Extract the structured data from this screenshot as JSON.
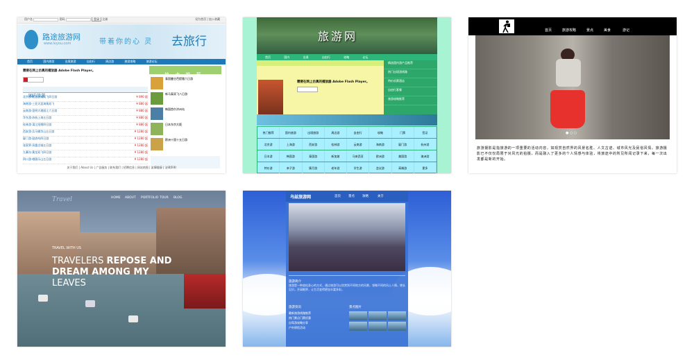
{
  "tile1": {
    "topbar_left": "用户名",
    "topbar_mid": "密码",
    "topbar_btn1": "登录",
    "topbar_btn2": "注册",
    "topbar_right": "设为首页 | 加入收藏",
    "logo_text": "路途旅游网",
    "logo_url": "www.lvyou.com",
    "slogan": "带着你的心 灵",
    "slogan_big": "去旅行",
    "nav": [
      "首页",
      "国内旅游",
      "出境旅游",
      "自由行",
      "周边游",
      "旅游攻略",
      "旅游论坛"
    ],
    "flash_message": "需要在网上仿真的播放器 Adobe Flash Player。",
    "section_title": "国内旅游",
    "rows": [
      {
        "name": "北京游·故宫长城双飞四日游",
        "price": "¥ 890 起"
      },
      {
        "name": "海南游·三亚天涯海角双飞",
        "price": "¥ 880 起"
      },
      {
        "name": "云南游·昆明大理丽江六日游",
        "price": "¥ 880 起"
      },
      {
        "name": "华东游·苏杭上海五日游",
        "price": "¥ 880 起"
      },
      {
        "name": "桂林游·漓江阳朔四日游",
        "price": "¥ 880 起"
      },
      {
        "name": "西安游·兵马俑华山五日游",
        "price": "¥ 1280 起"
      },
      {
        "name": "厦门游·鼓浪屿四日游",
        "price": "¥ 1280 起"
      },
      {
        "name": "张家界·凤凰古城五日游",
        "price": "¥ 1280 起"
      },
      {
        "name": "九寨沟·黄龙双飞四日游",
        "price": "¥ 1280 起"
      },
      {
        "name": "四川游·峨眉乐山五日游",
        "price": "¥ 1280 起"
      }
    ],
    "right_title": "热 点 推 荐",
    "right_items": [
      "泰国曼谷芭提雅六日游",
      "新马泰双飞八日游",
      "韩国首尔济州岛",
      "日本东京大阪",
      "欧洲十国十五日游"
    ],
    "footer": "关于我们 | About Us | 广告服务 | 联系我们 | 招聘信息 | 网站地图 | 友情链接 | 法律声明"
  },
  "tile2": {
    "title": "旅游网",
    "nav": [
      "首页",
      "国内",
      "出境",
      "自由行",
      "攻略",
      "论坛"
    ],
    "flash_message": "需要在网上仿真的播放器 Adobe Flash Player。",
    "green_list": [
      "精选国内游产品推荐",
      "热门出境游线路",
      "特价机票酒店",
      "自由行套餐",
      "旅游攻略推荐"
    ],
    "grid": [
      [
        "热门推荐",
        "国内旅游",
        "出境旅游",
        "周边游",
        "自由行",
        "攻略",
        "门票",
        "签证"
      ],
      [
        "北京游",
        "上海游",
        "西安游",
        "桂林游",
        "云南游",
        "海南游",
        "厦门游",
        "杭州游"
      ],
      [
        "日本游",
        "韩国游",
        "泰国游",
        "新加坡",
        "马来西亚",
        "欧洲游",
        "美国游",
        "澳洲游"
      ],
      [
        "特价游",
        "亲子游",
        "蜜月游",
        "老年游",
        "学生游",
        "会议游",
        "高端游",
        "更多"
      ]
    ]
  },
  "tile3": {
    "nav": [
      "首页",
      "旅游攻略",
      "景点",
      "美食",
      "游记"
    ],
    "dots": "● ○ ○",
    "paragraph": "旅游摄影是指旅游的一项重要的活动内容，如观赏自然界的风景名胜、人文古迹、城市风光及民俗风情。旅游摄影已不仅仅局限于对风光的拍摄，而是融入了更多的个人情感与体验，将旅途中的所见所闻记录下来，每一次出发都是新的开始。"
  },
  "tile4": {
    "logo": "Travel",
    "nav": [
      "HOME",
      "ABOUT",
      "PORTFOLIO",
      "TOUR",
      "BLOG"
    ],
    "kicker": "TRAVEL WITH US",
    "heading_line1_light": "TRAVELERS",
    "heading_line1_bold": "REPOSE AND",
    "heading_line2": "DREAM AMONG MY",
    "heading_line3": "LEAVES"
  },
  "tile5": {
    "brand": "乌兹旅游网",
    "nav": [
      "首页",
      "景点",
      "攻略",
      "关于"
    ],
    "intro_label": "旅游简介",
    "intro_text": "旅游是一种放松身心的方式，通过旅游可以欣赏到不同地方的风景，领略不同的风土人情，增长见识，开阔眼界，让生活变得更加丰富多彩。",
    "sub_left": "旅游资讯",
    "sub_right": "景点图片",
    "left_list": [
      "最新旅游线路推荐",
      "热门景点门票优惠",
      "自驾游攻略分享",
      "户外探险活动"
    ]
  }
}
